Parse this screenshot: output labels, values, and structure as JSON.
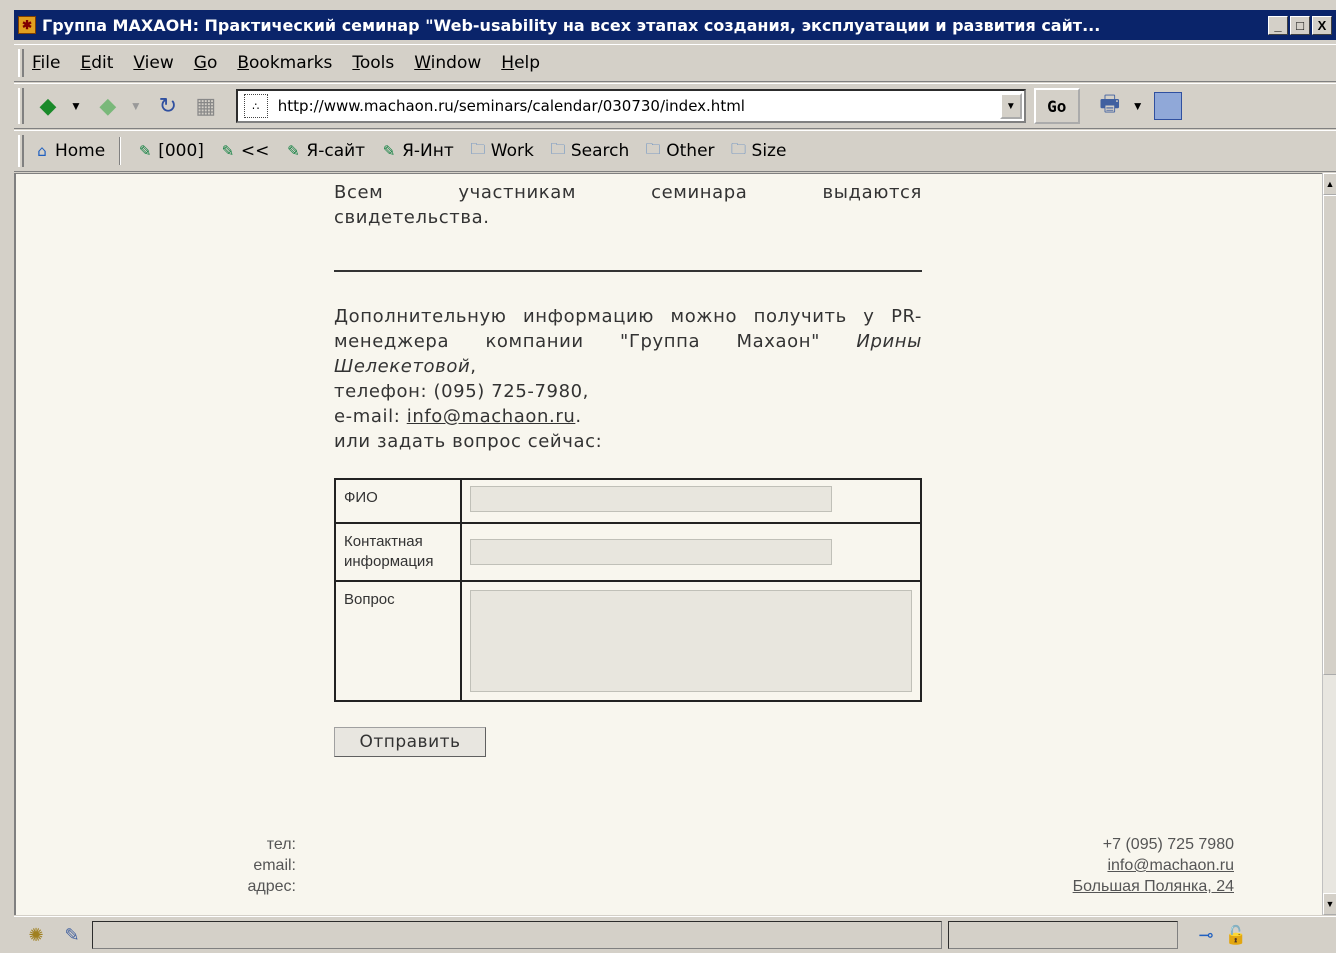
{
  "window": {
    "title": "Группа МАХАОН: Практический семинар \"Web-usability на всех этапах создания, эксплуатации и развития сайт...",
    "minimize": "_",
    "maximize": "□",
    "close": "X"
  },
  "menu": {
    "items": [
      {
        "label": "File",
        "key": "F",
        "rest": "ile"
      },
      {
        "label": "Edit",
        "key": "E",
        "rest": "dit"
      },
      {
        "label": "View",
        "key": "V",
        "rest": "iew"
      },
      {
        "label": "Go",
        "key": "G",
        "rest": "o"
      },
      {
        "label": "Bookmarks",
        "key": "B",
        "rest": "ookmarks"
      },
      {
        "label": "Tools",
        "key": "T",
        "rest": "ools"
      },
      {
        "label": "Window",
        "key": "W",
        "rest": "indow"
      },
      {
        "label": "Help",
        "key": "H",
        "rest": "elp"
      }
    ]
  },
  "nav": {
    "url": "http://www.machaon.ru/seminars/calendar/030730/index.html",
    "go_label": "Go"
  },
  "bookmarks": {
    "home": "Home",
    "items": [
      "[000]",
      "<<",
      "Я-сайт",
      "Я-Инт"
    ],
    "folders": [
      "Work",
      "Search",
      "Other",
      "Size"
    ]
  },
  "content": {
    "para1_words": [
      "Всем",
      "участникам",
      "семинара",
      "выдаются"
    ],
    "para1_line2": "свидетельства.",
    "para2_intro": "Дополнительную информацию можно получить у PR-менеджера компании \"Группа Махаон\"",
    "para2_name": "Ирины Шелекетовой",
    "para2_comma": ",",
    "phone_line": "телефон: (095) 725-7980,",
    "email_prefix": "e-mail: ",
    "email_link": "info@machaon.ru",
    "email_suffix": ".",
    "ask_line": "или задать вопрос сейчас:"
  },
  "form": {
    "fio_label": "ФИО",
    "contact_label": "Контактная информация",
    "question_label": "Вопрос",
    "fio_value": "",
    "contact_value": "",
    "question_value": "",
    "submit_label": "Отправить"
  },
  "footer": {
    "labels": [
      "тел:",
      "email:",
      "адрес:"
    ],
    "phone": "+7 (095) 725 7980",
    "email": "info@machaon.ru",
    "address": "Большая Полянка, 24"
  }
}
